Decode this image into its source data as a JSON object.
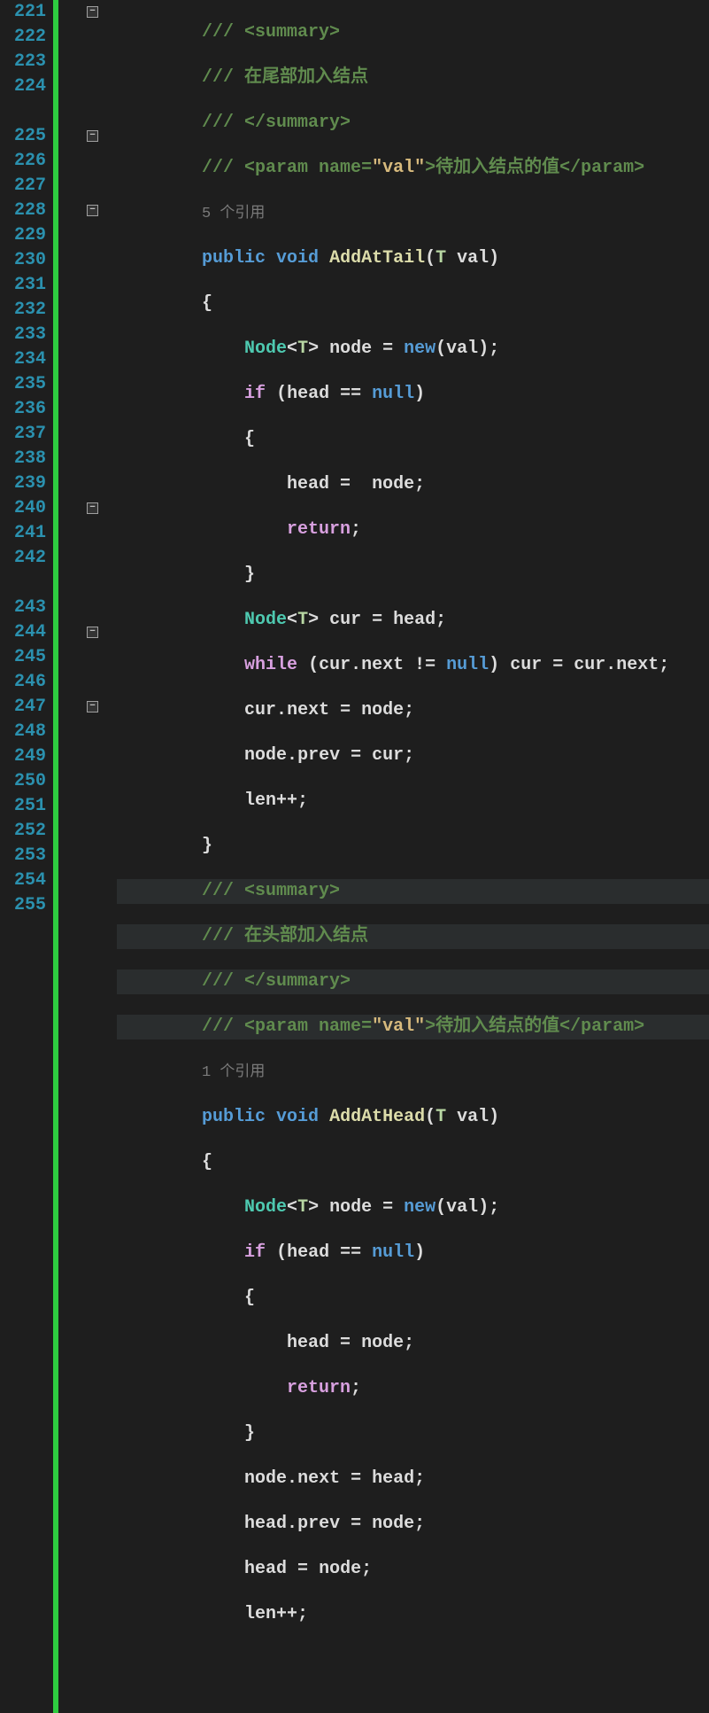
{
  "lines": {
    "221": "221",
    "222": "222",
    "223": "223",
    "224": "224",
    "225": "225",
    "226": "226",
    "227": "227",
    "228": "228",
    "229": "229",
    "230": "230",
    "231": "231",
    "232": "232",
    "233": "233",
    "234": "234",
    "235": "235",
    "236": "236",
    "237": "237",
    "238": "238",
    "239": "239",
    "240": "240",
    "241": "241",
    "242": "242",
    "243": "243",
    "244": "244",
    "245": "245",
    "246": "246",
    "247": "247",
    "248": "248",
    "249": "249",
    "250": "250",
    "251": "251",
    "252": "252",
    "253": "253",
    "254": "254",
    "255": "255"
  },
  "doc": {
    "slash": "/// ",
    "summary_open": "<summary>",
    "summary_close": "</summary>",
    "desc_tail": "在尾部加入结点",
    "desc_head": "在头部加入结点",
    "param_open": "<param ",
    "name_attr": "name",
    "eq": "=",
    "val_quoted": "\"val\"",
    "param_mid": ">",
    "param_text": "待加入结点的值",
    "param_close": "</param>"
  },
  "codelens": {
    "refs5": "5 个引用",
    "refs1": "1 个引用"
  },
  "kw": {
    "public": "public",
    "void": "void",
    "new": "new",
    "if": "if",
    "null": "null",
    "return": "return",
    "while": "while"
  },
  "id": {
    "AddAtTail": "AddAtTail",
    "AddAtHead": "AddAtHead",
    "Node": "Node",
    "T": "T",
    "val": "val",
    "node": "node",
    "head": "head",
    "cur": "cur",
    "next": "next",
    "prev": "prev",
    "len": "len"
  },
  "sym": {
    "lt": "<",
    "gt": ">",
    "lp": "(",
    "rp": ")",
    "lb": "{",
    "rb": "}",
    "eq": " = ",
    "eqeq": " == ",
    "neq": " != ",
    "semi": ";",
    "dot": ".",
    "pp": "++;",
    "sp": " ",
    "comma": ", "
  },
  "fold_glyph": "−"
}
